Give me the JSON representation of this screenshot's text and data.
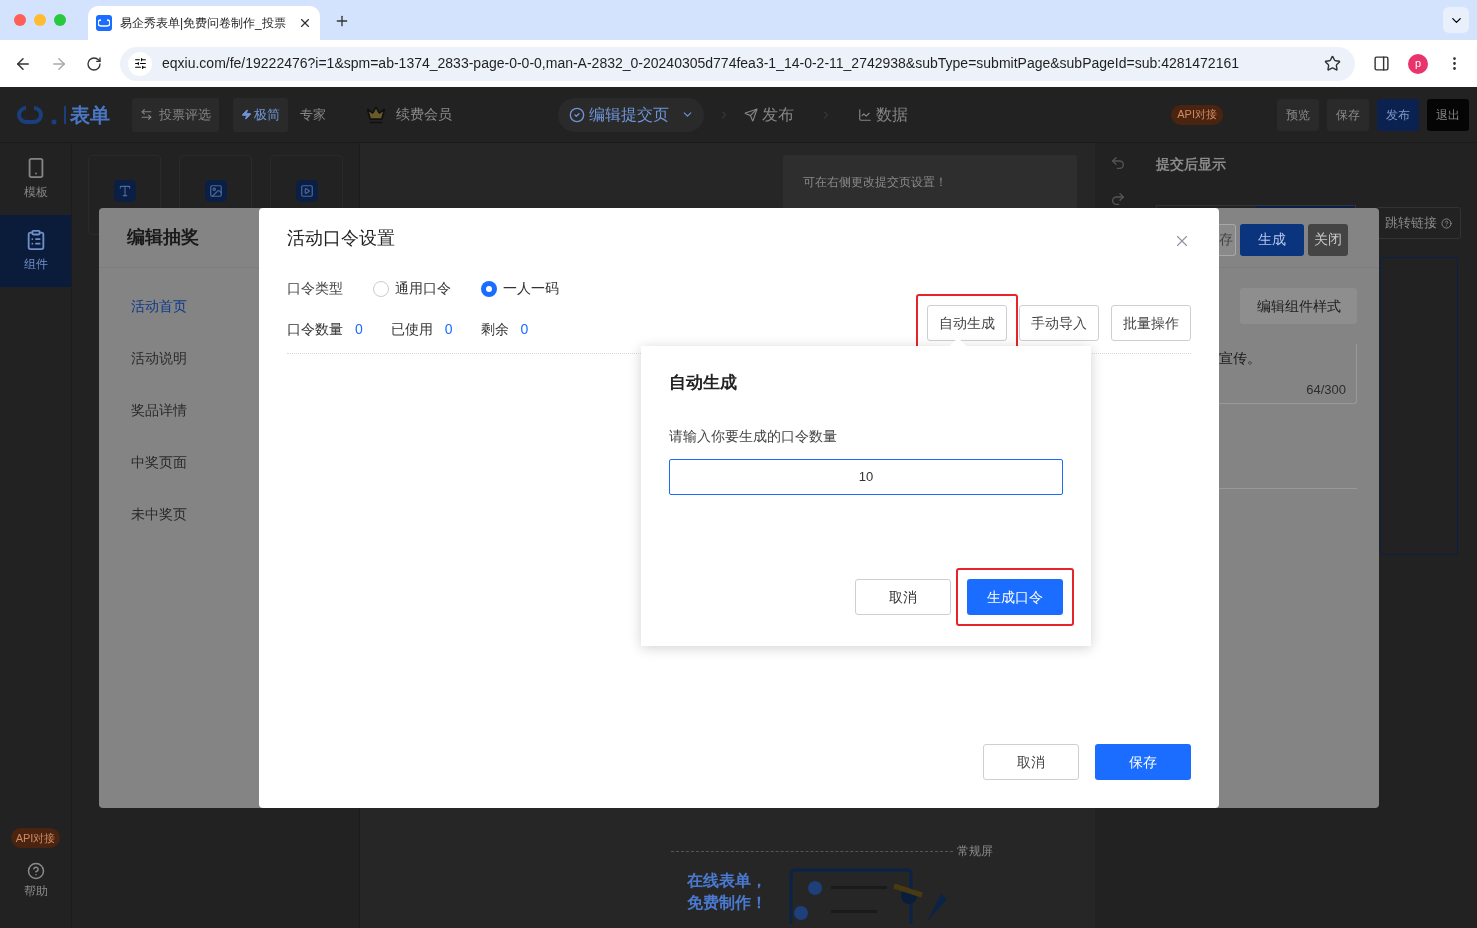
{
  "browser": {
    "tab_title": "易企秀表单|免费问卷制作_投票",
    "url": "eqxiu.com/fe/19222476?i=1&spm=ab-1374_2833-page-0-0-0,man-A-2832_0-20240305d774fea3-1_14-0-2-11_2742938&subType=submitPage&subPageId=sub:4281472161",
    "profile_initial": "p"
  },
  "header": {
    "logo": "表单",
    "scene": "投票评选",
    "modes": [
      {
        "label": "极简",
        "selected": true
      },
      {
        "label": "专家",
        "selected": false
      }
    ],
    "renew": "续费会员",
    "page_select": "编辑提交页",
    "nav": [
      "发布",
      "数据"
    ],
    "api_badge": "API对接",
    "actions": [
      {
        "label": "预览",
        "kind": "plain"
      },
      {
        "label": "保存",
        "kind": "plain"
      },
      {
        "label": "发布",
        "kind": "primary"
      },
      {
        "label": "退出",
        "kind": "dark"
      }
    ]
  },
  "rail": {
    "items": [
      {
        "label": "模板",
        "selected": false
      },
      {
        "label": "组件",
        "selected": true
      }
    ],
    "api_badge": "API对接",
    "help": "帮助"
  },
  "canvas": {
    "notice": "可在右侧更改提交页设置！",
    "screen_label": "常规屏",
    "promo": [
      "在线表单，",
      "免费制作！"
    ]
  },
  "right_panel": {
    "title": "提交后显示",
    "jump_link": "跳转链接"
  },
  "lottery_modal": {
    "title": "编辑抽奖",
    "nav": [
      {
        "label": "活动首页",
        "selected": true
      },
      {
        "label": "活动说明",
        "selected": false
      },
      {
        "label": "奖品详情",
        "selected": false
      },
      {
        "label": "中奖页面",
        "selected": false
      },
      {
        "label": "未中奖页",
        "selected": false
      }
    ],
    "toolbar": [
      {
        "label": "存",
        "kind": "outline"
      },
      {
        "label": "生成",
        "kind": "primary"
      },
      {
        "label": "关闭",
        "kind": "dark"
      }
    ],
    "style_button": "编辑组件样式",
    "text_tail": "宣传。",
    "counter": "64/300"
  },
  "code_modal": {
    "title": "活动口令设置",
    "type_label": "口令类型",
    "options": [
      {
        "label": "通用口令",
        "selected": false
      },
      {
        "label": "一人一码",
        "selected": true
      }
    ],
    "stats": [
      {
        "label": "口令数量",
        "value": "0"
      },
      {
        "label": "已使用",
        "value": "0"
      },
      {
        "label": "剩余",
        "value": "0"
      }
    ],
    "actions": [
      {
        "label": "自动生成",
        "highlighted": true
      },
      {
        "label": "手动导入",
        "highlighted": false
      },
      {
        "label": "批量操作",
        "highlighted": false
      }
    ],
    "cancel": "取消",
    "save": "保存"
  },
  "popover": {
    "title": "自动生成",
    "prompt": "请输入你要生成的口令数量",
    "value": "10",
    "cancel": "取消",
    "confirm": {
      "label": "生成口令",
      "highlighted": true
    }
  }
}
